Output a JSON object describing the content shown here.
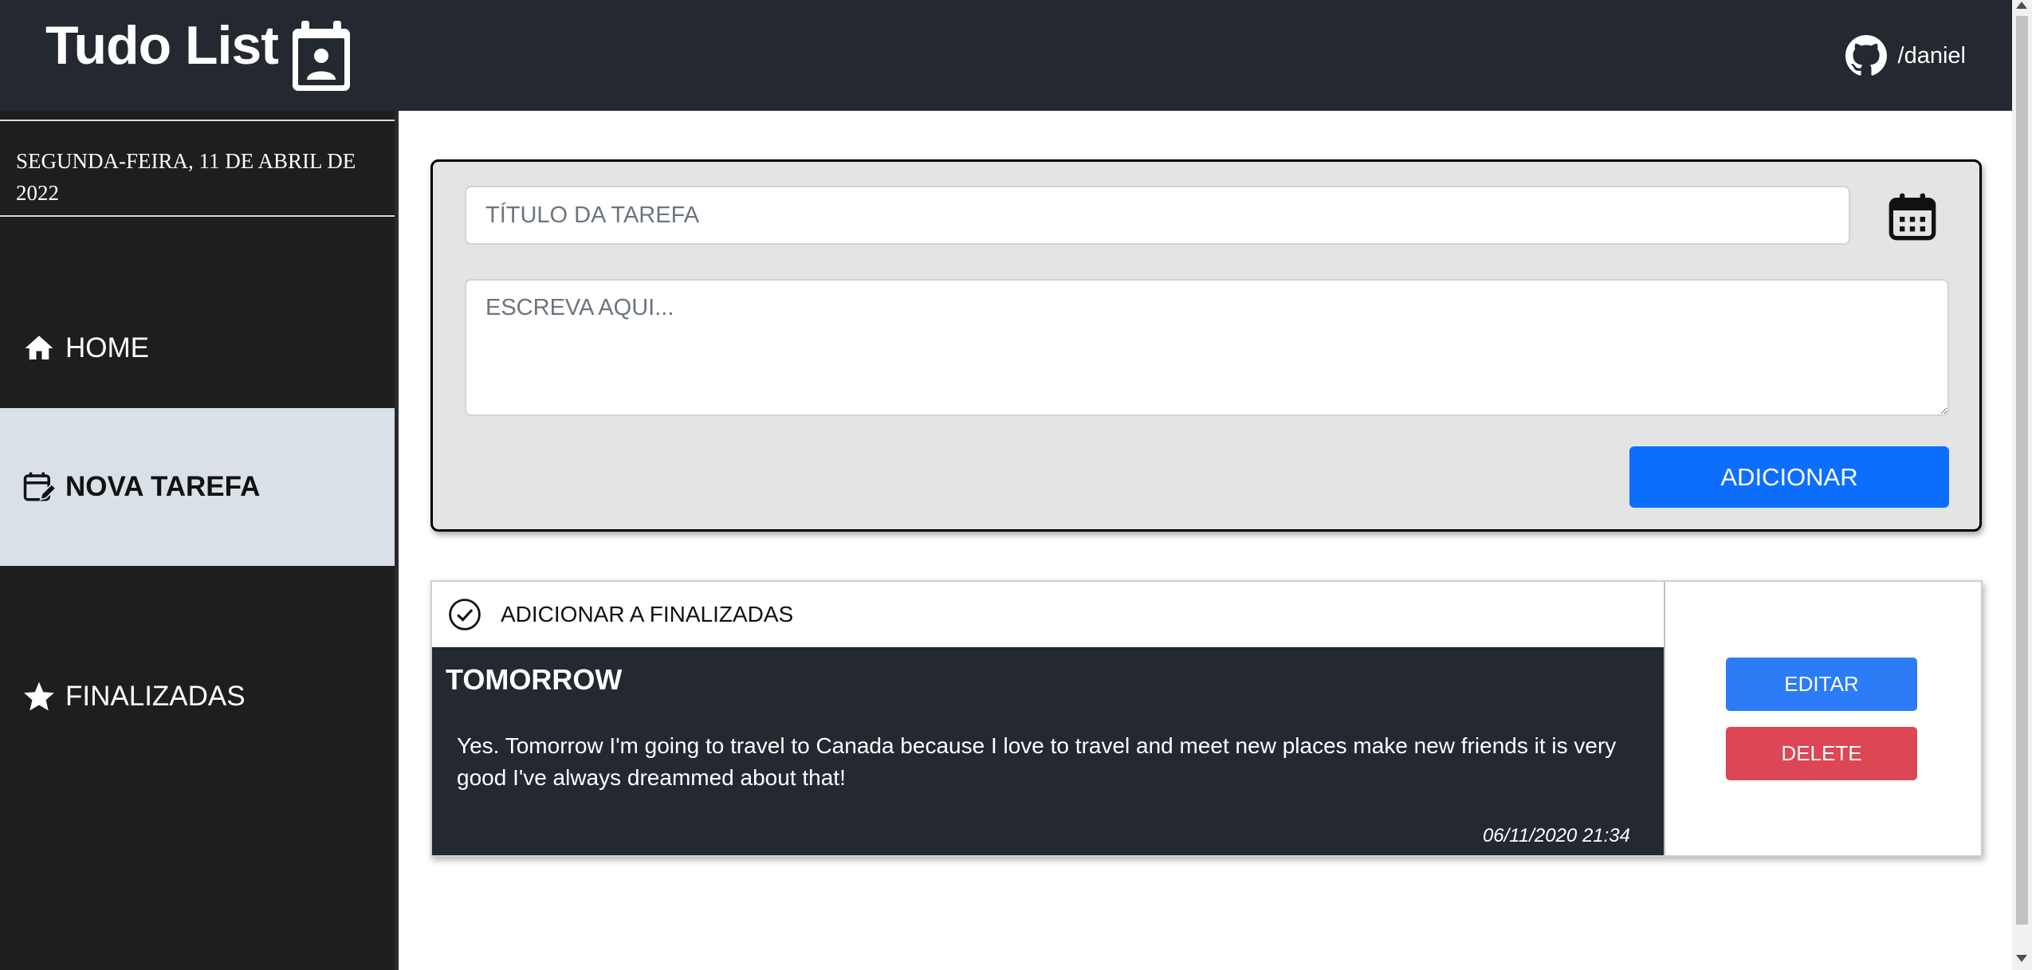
{
  "header": {
    "app_title": "Tudo List",
    "logo_icon": "calendar-user-icon",
    "github_icon": "github-icon",
    "github_user": "/daniel"
  },
  "sidebar": {
    "date": "SEGUNDA-FEIRA, 11 DE ABRIL DE 2022",
    "items": [
      {
        "label": "HOME",
        "icon": "home-icon",
        "active": false
      },
      {
        "label": "NOVA TAREFA",
        "icon": "calendar-edit-icon",
        "active": true
      },
      {
        "label": "FINALIZADAS",
        "icon": "star-icon",
        "active": false
      }
    ]
  },
  "form": {
    "title_placeholder": "TÍTULO DA TAREFA",
    "title_value": "",
    "description_placeholder": "ESCREVA AQUI...",
    "description_value": "",
    "calendar_icon": "calendar-icon",
    "add_label": "ADICIONAR"
  },
  "tasks": [
    {
      "finalize_label": "ADICIONAR A FINALIZADAS",
      "title": "TOMORROW",
      "description": "Yes. Tomorrow I'm going to travel to Canada because I love to travel and meet new places make new friends it is very good I've always dreammed about that!",
      "date": "06/11/2020 21:34",
      "edit_label": "EDITAR",
      "delete_label": "DELETE"
    }
  ],
  "colors": {
    "header_bg": "#242830",
    "sidebar_bg": "#1e1e1e",
    "active_item_bg": "#d9e0e8",
    "primary": "#0d6efd",
    "danger": "#dc4655"
  }
}
